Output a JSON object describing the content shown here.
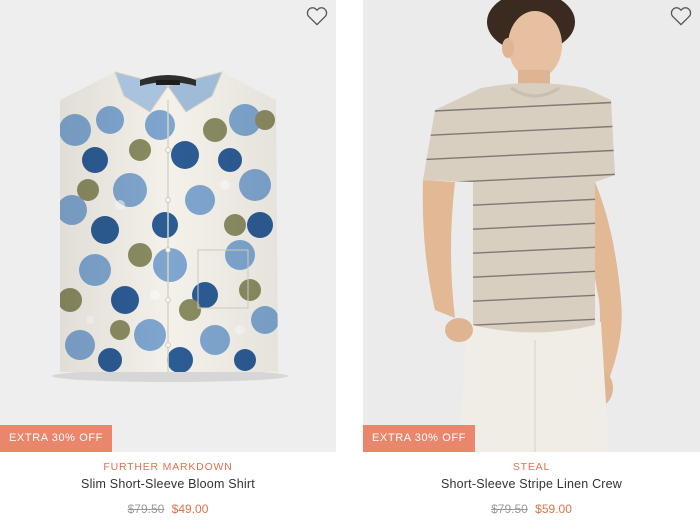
{
  "colors": {
    "accent": "#e0714f",
    "badge_bg": "#e9866c",
    "strike": "#9a9a9a"
  },
  "products": [
    {
      "badge": "EXTRA 30% OFF",
      "tag": "FURTHER MARKDOWN",
      "name": "Slim Short-Sleeve Bloom Shirt",
      "original_price": "$79.50",
      "sale_price": "$49.00",
      "wishlist_icon": "heart-outline-icon"
    },
    {
      "badge": "EXTRA 30% OFF",
      "tag": "STEAL",
      "name": "Short-Sleeve Stripe Linen Crew",
      "original_price": "$79.50",
      "sale_price": "$59.00",
      "wishlist_icon": "heart-outline-icon"
    }
  ]
}
